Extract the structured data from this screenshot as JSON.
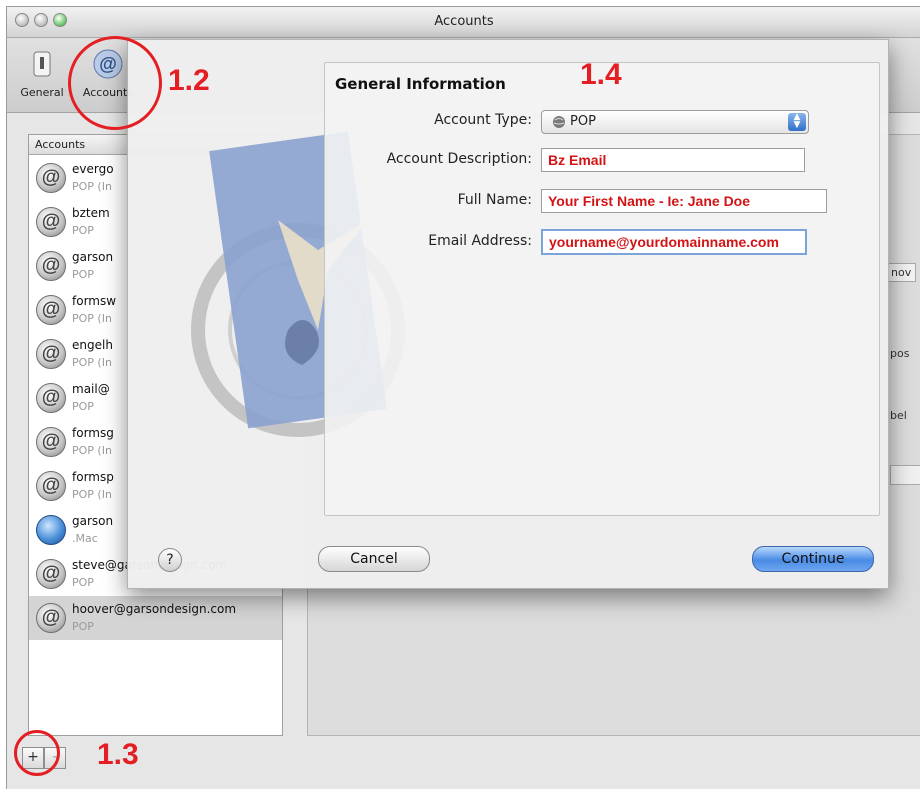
{
  "window": {
    "title": "Accounts"
  },
  "toolbar": {
    "items": [
      {
        "label": "General",
        "icon": "switch-icon"
      },
      {
        "label": "Accounts",
        "icon": "at-sign-icon"
      }
    ]
  },
  "sidebar": {
    "header": "Accounts",
    "accounts": [
      {
        "name": "evergo",
        "type": "POP (In"
      },
      {
        "name": "bztem",
        "type": "POP"
      },
      {
        "name": "garson",
        "type": "POP"
      },
      {
        "name": "formsw",
        "type": "POP (In"
      },
      {
        "name": "engelh",
        "type": "POP (In"
      },
      {
        "name": "mail@",
        "type": "POP"
      },
      {
        "name": "formsg",
        "type": "POP (In"
      },
      {
        "name": "formsp",
        "type": "POP (In"
      },
      {
        "name": "garson",
        "type": ".Mac"
      },
      {
        "name": "steve@garsondesign.com",
        "type": "POP"
      },
      {
        "name": "hoover@garsondesign.com",
        "type": "POP"
      }
    ],
    "add_label": "+",
    "remove_label": "-"
  },
  "right_peek": {
    "remove_text": "nov",
    "pos_text": "pos",
    "bel_text": "bel"
  },
  "sheet": {
    "section_title": "General Information",
    "account_type": {
      "label": "Account Type:",
      "value": "POP"
    },
    "description": {
      "label": "Account Description:",
      "value": "Bz Email"
    },
    "full_name": {
      "label": "Full Name:",
      "value": "Your First Name - Ie: Jane Doe"
    },
    "email": {
      "label": "Email Address:",
      "value": "yourname@yourdomainname.com"
    },
    "help_label": "?",
    "cancel_label": "Cancel",
    "continue_label": "Continue"
  },
  "annotations": {
    "step_1_2": "1.2",
    "step_1_3": "1.3",
    "step_1_4": "1.4",
    "color": "#e41f24"
  }
}
